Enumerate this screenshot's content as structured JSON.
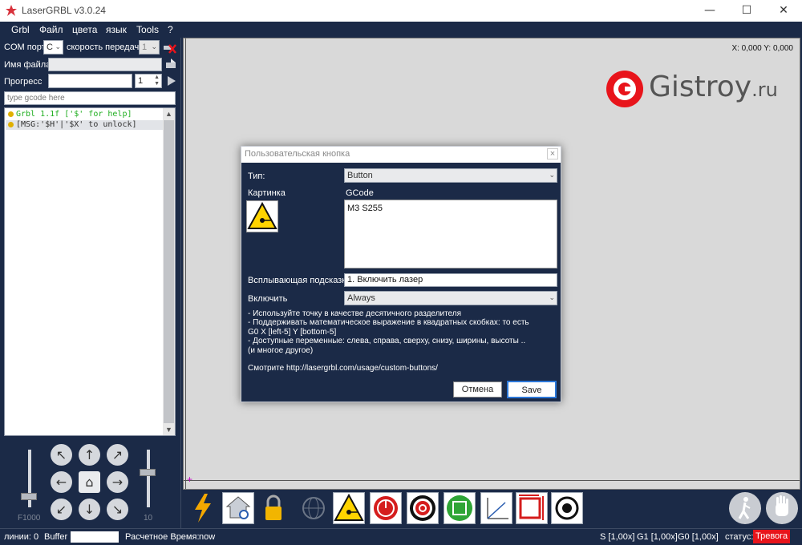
{
  "window": {
    "title": "LaserGRBL v3.0.24",
    "minimize": "—",
    "maximize": "☐",
    "close": "✕"
  },
  "menu": [
    "Grbl",
    "Файл",
    "цвета",
    "язык",
    "Tools",
    "?"
  ],
  "connection": {
    "com_label": "COM порт",
    "com_value": "C",
    "baud_label": "скорость передачи",
    "baud_value": "1",
    "file_label": "Имя файла",
    "file_value": "",
    "progress_label": "Прогресс",
    "progress_value": 0,
    "copies_value": "1",
    "gcode_placeholder": "type gcode here"
  },
  "console": {
    "lines": [
      {
        "text": "Grbl 1.1f ['$' for help]",
        "color": "#1fae1f"
      },
      {
        "text": "[MSG:'$H'|'$X' to unlock]",
        "color": "#333333"
      }
    ]
  },
  "jog": {
    "left_slider_label": "F1000",
    "right_slider_label": "10",
    "arrows": [
      "↖",
      "↑",
      "↗",
      "←",
      "⌂",
      "→",
      "↙",
      "↓",
      "↘"
    ]
  },
  "preview": {
    "coords": "X: 0,000 Y: 0,000",
    "watermark": "Gistroy",
    "watermark_suffix": ".ru"
  },
  "dialog": {
    "title": "Пользовательская кнопка",
    "close": "×",
    "type_label": "Тип:",
    "type_value": "Button",
    "image_label": "Картинка",
    "gcode_label": "GCode",
    "gcode_value": "M3 S255",
    "tooltip_label": "Всплывающая подсказка",
    "tooltip_value": "1. Включить лазер",
    "enable_label": "Включить",
    "enable_value": "Always",
    "help_lines": [
      "- Используйте точку в качестве десятичного разделителя",
      "- Поддерживать математическое выражение в квадратных скобках: то есть",
      "G0 X [left-5] Y [bottom-5]",
      "- Доступные переменные: слева, справа, сверху, снизу, ширины, высоты ..",
      "(и многое другое)"
    ],
    "link_text": "Смотрите http://lasergrbl.com/usage/custom-buttons/",
    "cancel_label": "Отмена",
    "save_label": "Save"
  },
  "toolbar": {
    "icons": [
      "lightning-icon",
      "home-zoom-icon",
      "padlock-icon",
      "globe-icon",
      "laser-warning-icon",
      "red-power-icon",
      "target-icon",
      "green-frame-icon",
      "axes-icon",
      "red-resize-icon",
      "circle-dot-icon"
    ],
    "walk_icon": "walk-icon",
    "stop_icon": "hand-stop-icon"
  },
  "status": {
    "lines_label": "линии:",
    "lines_value": "0",
    "buffer_label": "Buffer",
    "time_label": "Расчетное Время:",
    "time_value": "now",
    "s_override": "S [1,00x]",
    "g1_override": "G1 [1,00x]",
    "g0_override": "G0 [1,00x]",
    "state_label": "статус:",
    "state_value": "Тревога",
    "state_color": "#e8141b"
  }
}
